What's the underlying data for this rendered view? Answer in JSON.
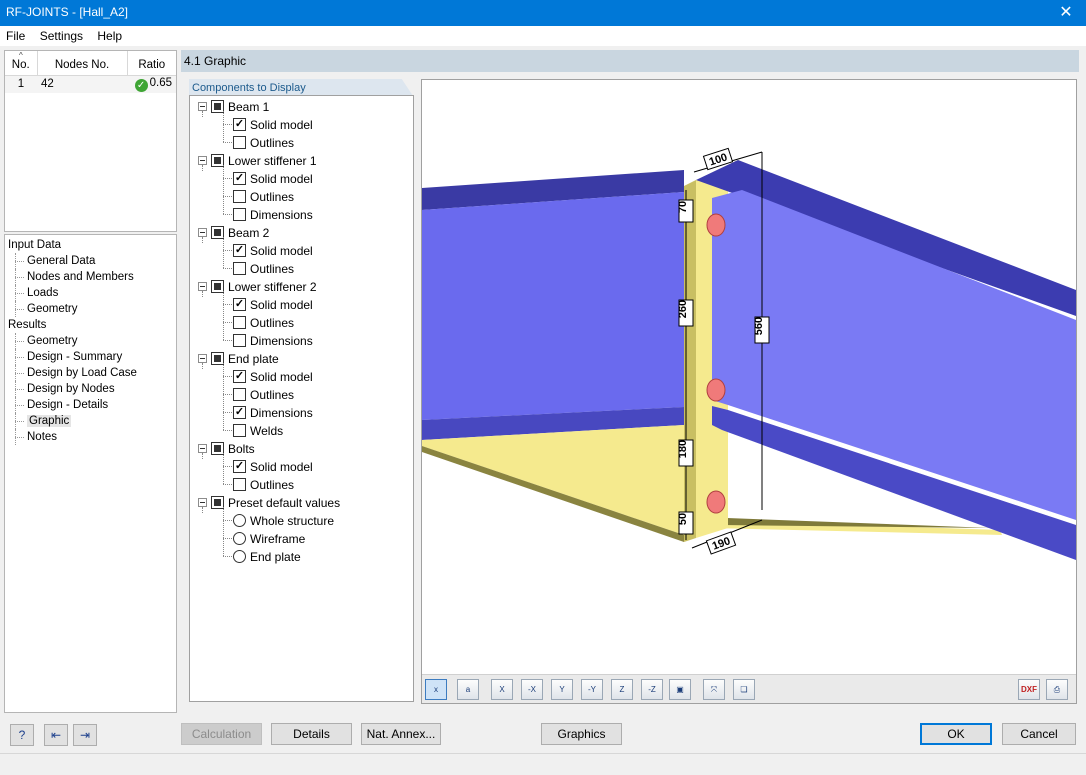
{
  "window": {
    "title": "RF-JOINTS - [Hall_A2]",
    "close_glyph": "✕"
  },
  "menu": [
    "File",
    "Settings",
    "Help"
  ],
  "nodes_table": {
    "columns": [
      "No.",
      "Nodes No.",
      "Ratio"
    ],
    "rows": [
      {
        "no": "1",
        "nodes": "42",
        "ratio": "0.65",
        "status": "ok"
      }
    ]
  },
  "nav_tree": [
    {
      "label": "Input Data",
      "level": 0
    },
    {
      "label": "General Data",
      "level": 1
    },
    {
      "label": "Nodes and Members",
      "level": 1
    },
    {
      "label": "Loads",
      "level": 1
    },
    {
      "label": "Geometry",
      "level": 1
    },
    {
      "label": "Results",
      "level": 0
    },
    {
      "label": "Geometry",
      "level": 1
    },
    {
      "label": "Design - Summary",
      "level": 1
    },
    {
      "label": "Design by Load Case",
      "level": 1
    },
    {
      "label": "Design by Nodes",
      "level": 1
    },
    {
      "label": "Design - Details",
      "level": 1
    },
    {
      "label": "Graphic",
      "level": 1,
      "selected": true
    },
    {
      "label": "Notes",
      "level": 1
    }
  ],
  "section_title": "4.1 Graphic",
  "components_tab": "Components to Display",
  "components": [
    {
      "label": "Beam 1",
      "children": [
        {
          "label": "Solid model",
          "checked": true
        },
        {
          "label": "Outlines",
          "checked": false
        }
      ]
    },
    {
      "label": "Lower stiffener 1",
      "children": [
        {
          "label": "Solid model",
          "checked": true
        },
        {
          "label": "Outlines",
          "checked": false
        },
        {
          "label": "Dimensions",
          "checked": false
        }
      ]
    },
    {
      "label": "Beam 2",
      "children": [
        {
          "label": "Solid model",
          "checked": true
        },
        {
          "label": "Outlines",
          "checked": false
        }
      ]
    },
    {
      "label": "Lower stiffener 2",
      "children": [
        {
          "label": "Solid model",
          "checked": true
        },
        {
          "label": "Outlines",
          "checked": false
        },
        {
          "label": "Dimensions",
          "checked": false
        }
      ]
    },
    {
      "label": "End plate",
      "children": [
        {
          "label": "Solid model",
          "checked": true
        },
        {
          "label": "Outlines",
          "checked": false
        },
        {
          "label": "Dimensions",
          "checked": true
        },
        {
          "label": "Welds",
          "checked": false
        }
      ]
    },
    {
      "label": "Bolts",
      "children": [
        {
          "label": "Solid model",
          "checked": true
        },
        {
          "label": "Outlines",
          "checked": false
        }
      ]
    },
    {
      "label": "Preset default values",
      "radio": true,
      "children": [
        {
          "label": "Whole structure"
        },
        {
          "label": "Wireframe"
        },
        {
          "label": "End plate"
        }
      ]
    }
  ],
  "dimensions": {
    "top_width": "100",
    "top_edge": "70",
    "middle": "260",
    "lower": "180",
    "bottom_edge": "50",
    "height": "560",
    "bottom_width": "190"
  },
  "colors": {
    "beam": "#6e6ef2",
    "beam_dark": "#3838a8",
    "plate": "#f5ea8e",
    "bolt": "#f07a7a",
    "titlebar": "#0078d7"
  },
  "view_toolbar": [
    {
      "icon": "x-view-icon",
      "glyph": "x"
    },
    {
      "icon": "a-view-icon",
      "glyph": "a"
    },
    {
      "icon": "view-x-icon",
      "glyph": "X"
    },
    {
      "icon": "view-minus-x-icon",
      "glyph": "-X"
    },
    {
      "icon": "view-y-icon",
      "glyph": "Y"
    },
    {
      "icon": "view-minus-y-icon",
      "glyph": "-Y"
    },
    {
      "icon": "view-z-icon",
      "glyph": "Z"
    },
    {
      "icon": "view-minus-z-icon",
      "glyph": "-Z"
    },
    {
      "icon": "isometric-view-icon",
      "glyph": "▣"
    },
    {
      "icon": "zoom-reset-icon",
      "glyph": "⤧"
    },
    {
      "icon": "render-options-icon",
      "glyph": "❏"
    }
  ],
  "right_toolbar": [
    {
      "icon": "dxf-export-icon",
      "glyph": "DXF"
    },
    {
      "icon": "print-icon",
      "glyph": "⎙"
    }
  ],
  "footer": {
    "help_icon": "?",
    "prev_icon": "⇤",
    "next_icon": "⇥",
    "calculation": "Calculation",
    "details": "Details",
    "nat_annex": "Nat. Annex...",
    "graphics": "Graphics",
    "ok": "OK",
    "cancel": "Cancel"
  }
}
